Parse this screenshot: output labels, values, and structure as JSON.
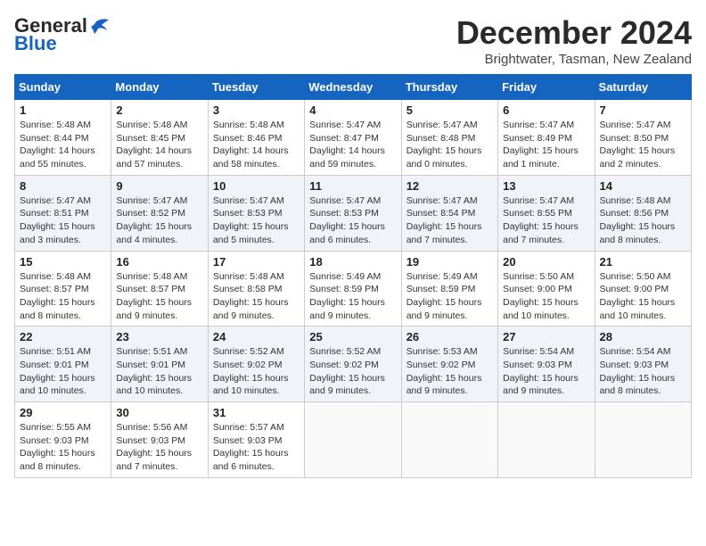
{
  "header": {
    "logo_general": "General",
    "logo_blue": "Blue",
    "month_title": "December 2024",
    "location": "Brightwater, Tasman, New Zealand"
  },
  "weekdays": [
    "Sunday",
    "Monday",
    "Tuesday",
    "Wednesday",
    "Thursday",
    "Friday",
    "Saturday"
  ],
  "weeks": [
    [
      {
        "day": "1",
        "info": "Sunrise: 5:48 AM\nSunset: 8:44 PM\nDaylight: 14 hours\nand 55 minutes."
      },
      {
        "day": "2",
        "info": "Sunrise: 5:48 AM\nSunset: 8:45 PM\nDaylight: 14 hours\nand 57 minutes."
      },
      {
        "day": "3",
        "info": "Sunrise: 5:48 AM\nSunset: 8:46 PM\nDaylight: 14 hours\nand 58 minutes."
      },
      {
        "day": "4",
        "info": "Sunrise: 5:47 AM\nSunset: 8:47 PM\nDaylight: 14 hours\nand 59 minutes."
      },
      {
        "day": "5",
        "info": "Sunrise: 5:47 AM\nSunset: 8:48 PM\nDaylight: 15 hours\nand 0 minutes."
      },
      {
        "day": "6",
        "info": "Sunrise: 5:47 AM\nSunset: 8:49 PM\nDaylight: 15 hours\nand 1 minute."
      },
      {
        "day": "7",
        "info": "Sunrise: 5:47 AM\nSunset: 8:50 PM\nDaylight: 15 hours\nand 2 minutes."
      }
    ],
    [
      {
        "day": "8",
        "info": "Sunrise: 5:47 AM\nSunset: 8:51 PM\nDaylight: 15 hours\nand 3 minutes."
      },
      {
        "day": "9",
        "info": "Sunrise: 5:47 AM\nSunset: 8:52 PM\nDaylight: 15 hours\nand 4 minutes."
      },
      {
        "day": "10",
        "info": "Sunrise: 5:47 AM\nSunset: 8:53 PM\nDaylight: 15 hours\nand 5 minutes."
      },
      {
        "day": "11",
        "info": "Sunrise: 5:47 AM\nSunset: 8:53 PM\nDaylight: 15 hours\nand 6 minutes."
      },
      {
        "day": "12",
        "info": "Sunrise: 5:47 AM\nSunset: 8:54 PM\nDaylight: 15 hours\nand 7 minutes."
      },
      {
        "day": "13",
        "info": "Sunrise: 5:47 AM\nSunset: 8:55 PM\nDaylight: 15 hours\nand 7 minutes."
      },
      {
        "day": "14",
        "info": "Sunrise: 5:48 AM\nSunset: 8:56 PM\nDaylight: 15 hours\nand 8 minutes."
      }
    ],
    [
      {
        "day": "15",
        "info": "Sunrise: 5:48 AM\nSunset: 8:57 PM\nDaylight: 15 hours\nand 8 minutes."
      },
      {
        "day": "16",
        "info": "Sunrise: 5:48 AM\nSunset: 8:57 PM\nDaylight: 15 hours\nand 9 minutes."
      },
      {
        "day": "17",
        "info": "Sunrise: 5:48 AM\nSunset: 8:58 PM\nDaylight: 15 hours\nand 9 minutes."
      },
      {
        "day": "18",
        "info": "Sunrise: 5:49 AM\nSunset: 8:59 PM\nDaylight: 15 hours\nand 9 minutes."
      },
      {
        "day": "19",
        "info": "Sunrise: 5:49 AM\nSunset: 8:59 PM\nDaylight: 15 hours\nand 9 minutes."
      },
      {
        "day": "20",
        "info": "Sunrise: 5:50 AM\nSunset: 9:00 PM\nDaylight: 15 hours\nand 10 minutes."
      },
      {
        "day": "21",
        "info": "Sunrise: 5:50 AM\nSunset: 9:00 PM\nDaylight: 15 hours\nand 10 minutes."
      }
    ],
    [
      {
        "day": "22",
        "info": "Sunrise: 5:51 AM\nSunset: 9:01 PM\nDaylight: 15 hours\nand 10 minutes."
      },
      {
        "day": "23",
        "info": "Sunrise: 5:51 AM\nSunset: 9:01 PM\nDaylight: 15 hours\nand 10 minutes."
      },
      {
        "day": "24",
        "info": "Sunrise: 5:52 AM\nSunset: 9:02 PM\nDaylight: 15 hours\nand 10 minutes."
      },
      {
        "day": "25",
        "info": "Sunrise: 5:52 AM\nSunset: 9:02 PM\nDaylight: 15 hours\nand 9 minutes."
      },
      {
        "day": "26",
        "info": "Sunrise: 5:53 AM\nSunset: 9:02 PM\nDaylight: 15 hours\nand 9 minutes."
      },
      {
        "day": "27",
        "info": "Sunrise: 5:54 AM\nSunset: 9:03 PM\nDaylight: 15 hours\nand 9 minutes."
      },
      {
        "day": "28",
        "info": "Sunrise: 5:54 AM\nSunset: 9:03 PM\nDaylight: 15 hours\nand 8 minutes."
      }
    ],
    [
      {
        "day": "29",
        "info": "Sunrise: 5:55 AM\nSunset: 9:03 PM\nDaylight: 15 hours\nand 8 minutes."
      },
      {
        "day": "30",
        "info": "Sunrise: 5:56 AM\nSunset: 9:03 PM\nDaylight: 15 hours\nand 7 minutes."
      },
      {
        "day": "31",
        "info": "Sunrise: 5:57 AM\nSunset: 9:03 PM\nDaylight: 15 hours\nand 6 minutes."
      },
      {
        "day": "",
        "info": ""
      },
      {
        "day": "",
        "info": ""
      },
      {
        "day": "",
        "info": ""
      },
      {
        "day": "",
        "info": ""
      }
    ]
  ]
}
